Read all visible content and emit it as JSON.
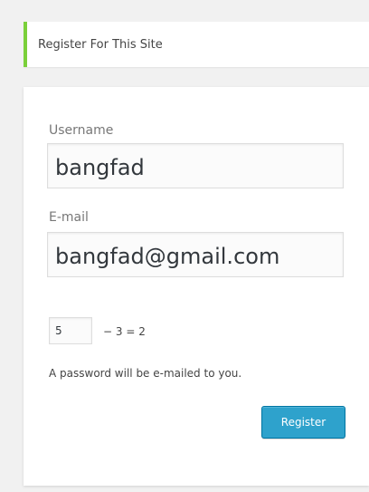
{
  "message": {
    "text": "Register For This Site",
    "accent_color": "#7ad03a"
  },
  "form": {
    "username": {
      "label": "Username",
      "value": "bangfad"
    },
    "email": {
      "label": "E-mail",
      "value": "bangfad@gmail.com"
    },
    "captcha": {
      "value": "5",
      "expression": "− 3 = 2"
    },
    "note": "A password will be e-mailed to you.",
    "submit_label": "Register",
    "button_color": "#2ea2cc"
  }
}
